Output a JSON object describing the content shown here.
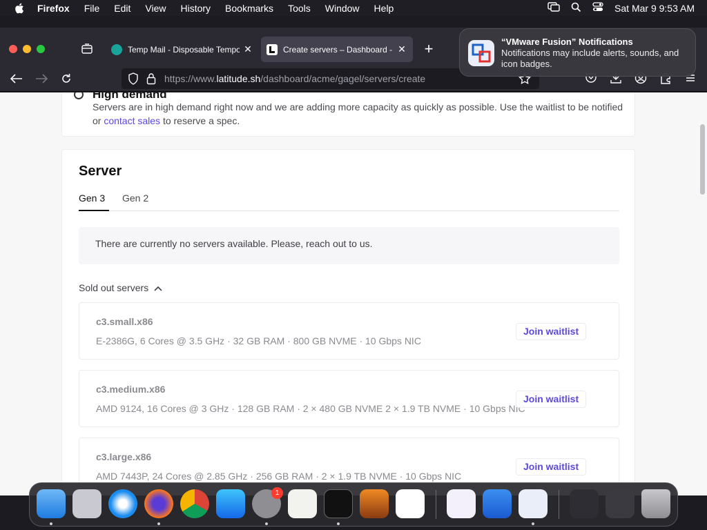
{
  "menubar": {
    "app": "Firefox",
    "items": [
      "File",
      "Edit",
      "View",
      "History",
      "Bookmarks",
      "Tools",
      "Window",
      "Help"
    ],
    "clock": "Sat Mar 9  9:53 AM"
  },
  "tabs": [
    {
      "title": "Temp Mail - Disposable Temporary Email",
      "active": false
    },
    {
      "title": "Create servers – Dashboard - Latitude.sh",
      "active": true
    }
  ],
  "urlbar": {
    "prefix": "https://www.",
    "host": "latitude.sh",
    "path": "/dashboard/acme/gagel/servers/create"
  },
  "notification": {
    "title": "“VMware Fusion” Notifications",
    "body": "Notifications may include alerts, sounds, and icon badges."
  },
  "high_demand": {
    "title": "High demand",
    "text_before": "Servers are in high demand right now and we are adding more capacity as quickly as possible. Use the waitlist to be notified or ",
    "link": "contact sales",
    "text_after": " to reserve a spec."
  },
  "server": {
    "title": "Server",
    "tabs": [
      "Gen 3",
      "Gen 2"
    ],
    "empty_message": "There are currently no servers available. Please, reach out to us.",
    "sold_out_label": "Sold out servers",
    "join_label": "Join waitlist",
    "items": [
      {
        "name": "c3.small.x86",
        "spec": "E-2386G, 6 Cores @ 3.5 GHz · 32 GB RAM · 800 GB NVME · 10 Gbps NIC"
      },
      {
        "name": "c3.medium.x86",
        "spec": "AMD 9124, 16 Cores @ 3 GHz · 128 GB RAM · 2 × 480 GB NVME 2 × 1.9 TB NVME · 10 Gbps NIC"
      },
      {
        "name": "c3.large.x86",
        "spec": "AMD 7443P, 24 Cores @ 2.85 GHz · 256 GB RAM · 2 × 1.9 TB NVME · 10 Gbps NIC"
      }
    ]
  },
  "dock": {
    "apps": [
      "finder-icon",
      "launchpad-icon",
      "safari-icon",
      "firefox-icon",
      "chrome-icon",
      "app-store-icon",
      "system-settings-icon",
      "textedit-icon",
      "terminal-icon",
      "garageband-icon",
      "vscode-icon",
      "visual-studio-icon",
      "icloud-icon",
      "vmware-fusion-icon",
      "preview-icon",
      "screenshot-icon",
      "trash-icon"
    ],
    "settings_badge": "1"
  },
  "colors": {
    "accent": "#5b48e0",
    "page_bg": "#f7f7f8",
    "chrome_bg": "#2b2a33"
  }
}
